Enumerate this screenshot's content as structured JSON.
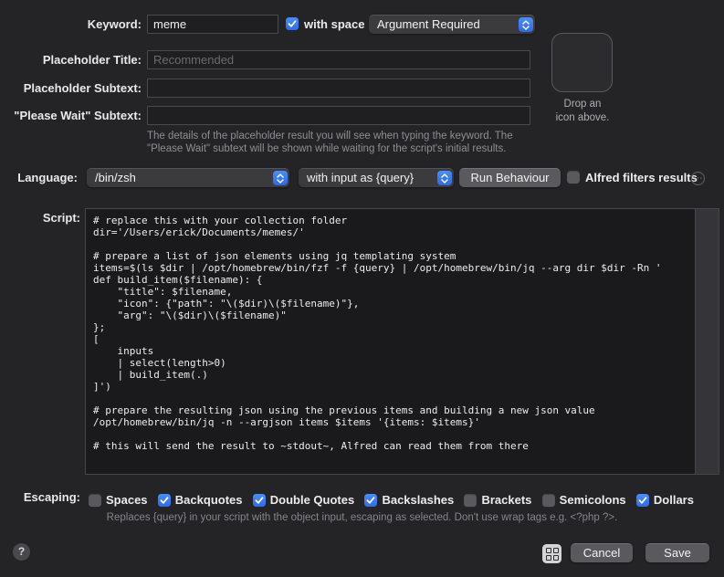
{
  "keyword_row": {
    "label": "Keyword:",
    "value": "meme",
    "with_space_label": "with space",
    "with_space_checked": true,
    "argument_select": "Argument Required"
  },
  "placeholder_title": {
    "label": "Placeholder Title:",
    "value": "",
    "placeholder": "Recommended"
  },
  "placeholder_subtext": {
    "label": "Placeholder Subtext:",
    "value": "",
    "placeholder": ""
  },
  "please_wait": {
    "label": "\"Please Wait\" Subtext:",
    "value": "",
    "placeholder": ""
  },
  "placeholder_hint": "The details of the placeholder result you will see when typing the keyword. The \"Please Wait\" subtext will be shown while waiting for the script's initial results.",
  "icon_well": {
    "caption": "Drop an\nicon above."
  },
  "language_row": {
    "label": "Language:",
    "language": "/bin/zsh",
    "input_mode": "with input as {query}",
    "run_button": "Run Behaviour",
    "filters_label": "Alfred filters results",
    "filters_checked": false,
    "options_icon": "ellipsis-icon"
  },
  "script": {
    "label": "Script:",
    "code": "# replace this with your collection folder\ndir='/Users/erick/Documents/memes/'\n\n# prepare a list of json elements using jq templating system\nitems=$(ls $dir | /opt/homebrew/bin/fzf -f {query} | /opt/homebrew/bin/jq --arg dir $dir -Rn '\ndef build_item($filename): {\n    \"title\": $filename,\n    \"icon\": {\"path\": \"\\($dir)\\($filename)\"},\n    \"arg\": \"\\($dir)\\($filename)\"\n};\n[\n    inputs\n    | select(length>0)\n    | build_item(.)\n]')\n\n# prepare the resulting json using the previous items and building a new json value\n/opt/homebrew/bin/jq -n --argjson items $items '{items: $items}'\n\n# this will send the result to ~stdout~, Alfred can read them from there"
  },
  "escaping": {
    "label": "Escaping:",
    "options": [
      {
        "label": "Spaces",
        "checked": false
      },
      {
        "label": "Backquotes",
        "checked": true
      },
      {
        "label": "Double Quotes",
        "checked": true
      },
      {
        "label": "Backslashes",
        "checked": true
      },
      {
        "label": "Brackets",
        "checked": false
      },
      {
        "label": "Semicolons",
        "checked": false
      },
      {
        "label": "Dollars",
        "checked": true
      }
    ]
  },
  "escaping_note": "Replaces {query} in your script with the object input, escaping as selected. Don't use wrap tags e.g. <?php ?>.",
  "footer": {
    "help": "?",
    "cancel": "Cancel",
    "save": "Save"
  },
  "colors": {
    "accent_blue": "#3478f6",
    "window_bg": "#242427",
    "script_bg": "#1a1a1c"
  }
}
